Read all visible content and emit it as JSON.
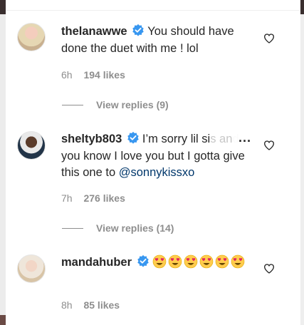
{
  "comments": [
    {
      "username": "thelanawwe",
      "text": "You should have done the duet with me ! lol",
      "time": "6h",
      "likes": "194 likes",
      "view_replies": "View replies (9)"
    },
    {
      "username": "sheltyb803",
      "text_before": "I’m sorry lil si",
      "text_faded": "s and",
      "text_after": " you know I love you but I gotta give this one to ",
      "mention": "@sonnykissxo",
      "time": "7h",
      "likes": "276 likes",
      "view_replies": "View replies (14)",
      "more_icon": "ellipsis-icon"
    },
    {
      "username": "mandahuber",
      "emoji_count": 6,
      "emoji_name": "heart-eyes-emoji",
      "time": "8h",
      "likes": "85 likes"
    }
  ],
  "colors": {
    "verified": "#3897f0",
    "mention": "#00376b",
    "muted": "#8e8e8e",
    "emoji": "#ffcc4d"
  }
}
